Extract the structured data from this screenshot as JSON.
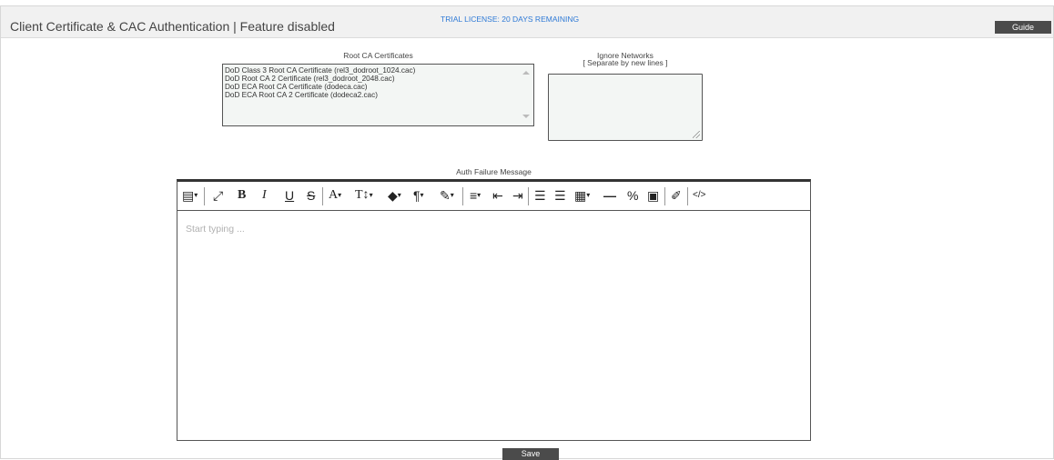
{
  "header": {
    "title": "Client Certificate & CAC Authentication | Feature disabled",
    "trial": "TRIAL LICENSE: 20 DAYS REMAINING",
    "guide_label": "Guide"
  },
  "root_ca": {
    "label": "Root CA Certificates",
    "items": [
      "DoD Class 3 Root CA Certificate (rel3_dodroot_1024.cac)",
      "DoD Root CA 2 Certificate (rel3_dodroot_2048.cac)",
      "DoD ECA Root CA Certificate (dodeca.cac)",
      "DoD ECA Root CA 2 Certificate (dodeca2.cac)"
    ]
  },
  "ignore_networks": {
    "label": "Ignore Networks",
    "hint": "[ Separate by new lines ]",
    "value": ""
  },
  "auth_failure": {
    "label": "Auth Failure Message",
    "placeholder": "Start typing ..."
  },
  "toolbar": {
    "icons": {
      "file": "▤",
      "fullscreen": "⤢",
      "bold": "B",
      "italic": "I",
      "underline": "U",
      "strike": "S",
      "font": "A",
      "font_size": "T↕",
      "color": "◆",
      "paragraph": "¶",
      "magic": "✎",
      "align": "≡",
      "outdent": "⇤",
      "indent": "⇥",
      "ol": "☰",
      "ul": "☰",
      "table": "▦",
      "hr": "—",
      "link": "%",
      "image": "▣",
      "eraser": "✐",
      "source": "</>",
      "dropdown": "▾"
    }
  },
  "footer": {
    "save_label": "Save"
  }
}
